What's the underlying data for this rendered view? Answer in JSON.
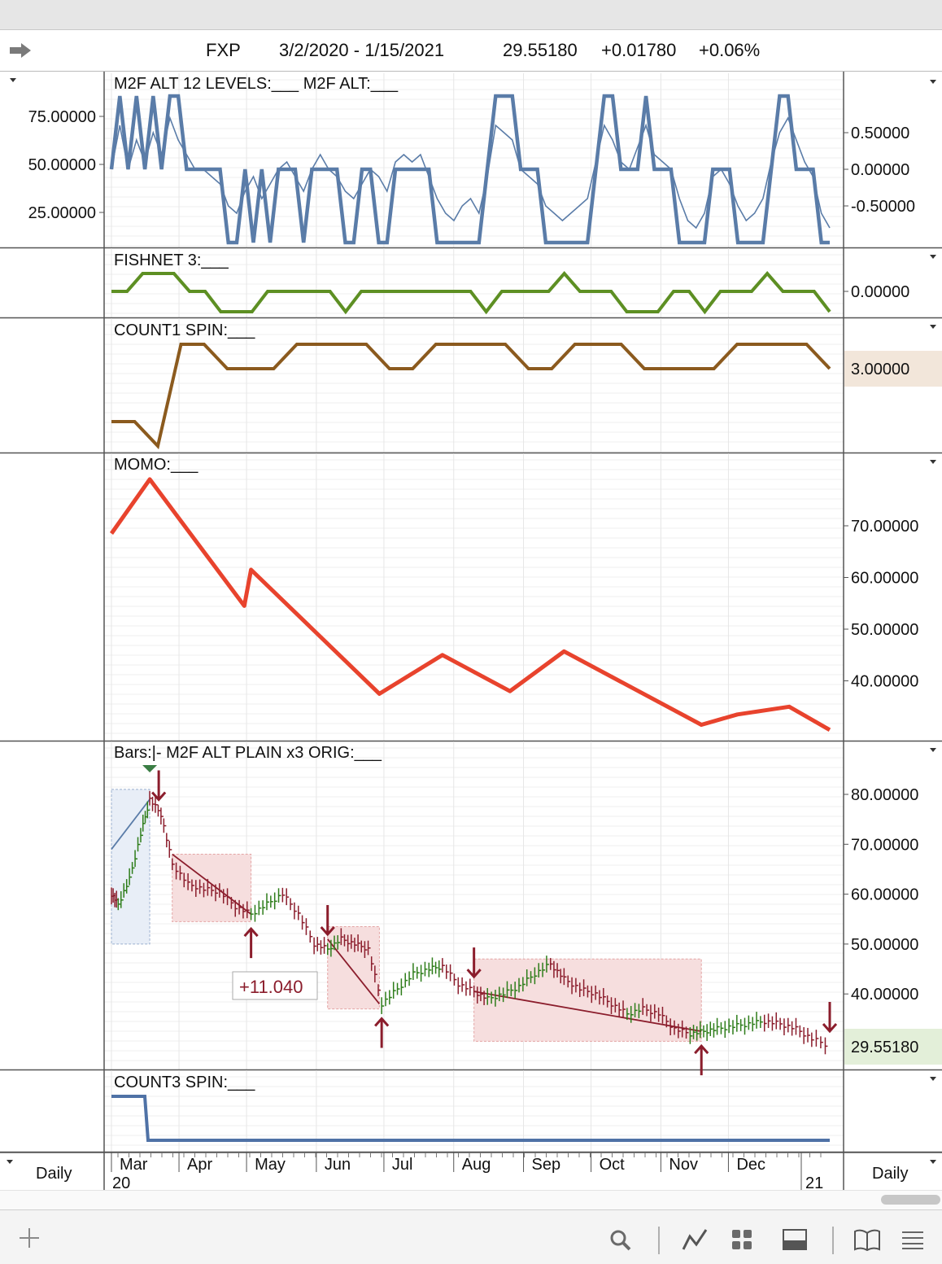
{
  "header": {
    "symbol": "FXP",
    "date_range": "3/2/2020 - 1/15/2021",
    "last": "29.55180",
    "change": "+0.01780",
    "change_pct": "+0.06%"
  },
  "footer": {
    "left_period": "Daily",
    "right_period": "Daily"
  },
  "colors": {
    "m2f": "#5a7ca8",
    "fishnet": "#5d8f23",
    "count1": "#8b5a1e",
    "momo": "#e8432d",
    "count3": "#4f72a6",
    "down_bar": "#8b1d2c",
    "up_bar": "#2e7d1a",
    "box_fill": "#f6dede"
  },
  "chart_data": [
    {
      "panel": "m2f",
      "type": "line",
      "title": "M2F ALT 12 LEVELS:___   M2F ALT:___",
      "left_ticks": [
        "75.00000",
        "50.00000",
        "25.00000"
      ],
      "right_ticks": [
        "0.50000",
        "0.00000",
        "-0.50000"
      ],
      "series": [
        {
          "name": "M2F ALT 12 LEVELS",
          "values": [
            50,
            100,
            50,
            100,
            50,
            100,
            50,
            100,
            100,
            50,
            50,
            50,
            50,
            50,
            0,
            0,
            50,
            0,
            50,
            0,
            50,
            50,
            50,
            0,
            50,
            50,
            50,
            50,
            0,
            0,
            50,
            50,
            0,
            0,
            50,
            50,
            50,
            50,
            50,
            0,
            0,
            0,
            0,
            0,
            0,
            50,
            100,
            100,
            100,
            50,
            50,
            50,
            0,
            0,
            0,
            0,
            0,
            0,
            50,
            100,
            100,
            50,
            50,
            50,
            100,
            50,
            50,
            50,
            0,
            0,
            0,
            0,
            50,
            50,
            50,
            0,
            0,
            0,
            0,
            50,
            100,
            100,
            50,
            50,
            50,
            0,
            0
          ]
        },
        {
          "name": "M2F ALT",
          "values": [
            50,
            80,
            50,
            70,
            55,
            75,
            60,
            85,
            70,
            60,
            50,
            50,
            45,
            40,
            25,
            20,
            35,
            45,
            30,
            40,
            50,
            55,
            45,
            35,
            50,
            60,
            50,
            45,
            35,
            30,
            40,
            50,
            45,
            35,
            55,
            60,
            55,
            60,
            45,
            30,
            20,
            15,
            25,
            30,
            20,
            45,
            80,
            75,
            70,
            50,
            45,
            40,
            25,
            20,
            15,
            20,
            25,
            30,
            55,
            80,
            70,
            55,
            50,
            65,
            80,
            60,
            55,
            50,
            30,
            15,
            10,
            20,
            45,
            50,
            40,
            25,
            15,
            20,
            30,
            55,
            75,
            85,
            70,
            55,
            45,
            20,
            10
          ]
        }
      ]
    },
    {
      "panel": "fishnet",
      "type": "line",
      "title": "FISHNET 3:___",
      "right_ticks": [
        "0.00000"
      ],
      "values": [
        0,
        0,
        1,
        1,
        1,
        0,
        0,
        -1,
        -1,
        -1,
        0,
        0,
        0,
        0,
        0,
        -1,
        0,
        0,
        0,
        0,
        0,
        0,
        0,
        0,
        -1,
        0,
        0,
        0,
        0,
        1,
        0,
        0,
        0,
        -1,
        -1,
        -1,
        0,
        0,
        -1,
        0,
        0,
        0,
        1,
        0,
        0,
        0,
        -1
      ]
    },
    {
      "panel": "count1",
      "type": "line",
      "title": "COUNT1 SPIN:___",
      "right_ticks": [
        "3.00000"
      ],
      "last_value": "3.00000",
      "values": [
        1,
        1,
        0,
        4,
        4,
        3,
        3,
        3,
        4,
        4,
        4,
        4,
        3,
        3,
        4,
        4,
        4,
        4,
        3,
        3,
        4,
        4,
        4,
        3,
        3,
        3,
        3,
        4,
        4,
        4,
        4,
        3
      ]
    },
    {
      "panel": "momo",
      "type": "line",
      "title": "MOMO:___",
      "y_ticks": [
        "70.00000",
        "60.00000",
        "50.00000",
        "40.00000"
      ],
      "ylim": [
        30,
        80
      ],
      "x": [
        "2020-03-02",
        "2020-03-19",
        "2020-04-30",
        "2020-05-03",
        "2020-06-29",
        "2020-07-27",
        "2020-08-26",
        "2020-09-19",
        "2020-11-19",
        "2020-12-05",
        "2020-12-28",
        "2021-01-15"
      ],
      "values": [
        68.5,
        79,
        54.5,
        61.5,
        37.5,
        45,
        38,
        45.7,
        31.5,
        33.5,
        35,
        30.5
      ]
    },
    {
      "panel": "price",
      "type": "line",
      "title": "Bars:|-   M2F ALT PLAIN x3 ORIG:___",
      "y_ticks": [
        "80.00000",
        "70.00000",
        "60.00000",
        "50.00000",
        "40.00000"
      ],
      "ylim": [
        25,
        85
      ],
      "last_price": "29.55180",
      "x": [
        "2020-03-02",
        "2020-03-05",
        "2020-03-10",
        "2020-03-15",
        "2020-03-19",
        "2020-03-24",
        "2020-03-29",
        "2020-04-05",
        "2020-04-12",
        "2020-04-19",
        "2020-04-26",
        "2020-05-03",
        "2020-05-10",
        "2020-05-17",
        "2020-05-24",
        "2020-05-31",
        "2020-06-06",
        "2020-06-12",
        "2020-06-18",
        "2020-06-24",
        "2020-06-30",
        "2020-07-07",
        "2020-07-14",
        "2020-07-21",
        "2020-07-27",
        "2020-08-03",
        "2020-08-10",
        "2020-08-16",
        "2020-08-23",
        "2020-08-30",
        "2020-09-06",
        "2020-09-13",
        "2020-09-19",
        "2020-09-26",
        "2020-10-03",
        "2020-10-10",
        "2020-10-17",
        "2020-10-24",
        "2020-10-31",
        "2020-11-07",
        "2020-11-14",
        "2020-11-20",
        "2020-11-26",
        "2020-12-03",
        "2020-12-10",
        "2020-12-17",
        "2020-12-24",
        "2020-12-31",
        "2021-01-07",
        "2021-01-15"
      ],
      "values": [
        60,
        58,
        63,
        72,
        79,
        76,
        66,
        62,
        61,
        60.5,
        57.5,
        56,
        58,
        60,
        56,
        50,
        49,
        51,
        50,
        49,
        38,
        41,
        44,
        45,
        45.5,
        42,
        40.5,
        39,
        40,
        41.5,
        44,
        46,
        43,
        41,
        40,
        38,
        36,
        37,
        36,
        33,
        32,
        32.5,
        33,
        33.5,
        34,
        34.5,
        34,
        33,
        31,
        29.6
      ],
      "annotations": [
        "+11.040"
      ],
      "regression_boxes": [
        {
          "from": "2020-03-02",
          "to": "2020-03-19",
          "high": 81,
          "low": 50,
          "start": 69,
          "end": 79,
          "direction": "up"
        },
        {
          "from": "2020-03-29",
          "to": "2020-05-03",
          "high": 68,
          "low": 54.5,
          "start": 68,
          "end": 56,
          "direction": "down"
        },
        {
          "from": "2020-06-06",
          "to": "2020-06-29",
          "high": 53.5,
          "low": 37,
          "start": 51,
          "end": 38,
          "direction": "down"
        },
        {
          "from": "2020-08-10",
          "to": "2020-11-19",
          "high": 47,
          "low": 30.5,
          "start": 40.5,
          "end": 32.5,
          "direction": "down"
        }
      ],
      "signals": [
        {
          "date": "2020-03-23",
          "type": "down"
        },
        {
          "date": "2020-05-03",
          "type": "up"
        },
        {
          "date": "2020-06-06",
          "type": "down"
        },
        {
          "date": "2020-06-30",
          "type": "up"
        },
        {
          "date": "2020-08-10",
          "type": "down"
        },
        {
          "date": "2020-11-19",
          "type": "up"
        },
        {
          "date": "2021-01-15",
          "type": "down"
        }
      ]
    },
    {
      "panel": "count3",
      "type": "line",
      "title": "COUNT3 SPIN:___",
      "values": [
        1,
        1,
        1,
        0,
        0,
        0,
        0,
        0,
        0,
        0
      ]
    }
  ],
  "x_axis": {
    "months": [
      "Mar",
      "Apr",
      "May",
      "Jun",
      "Jul",
      "Aug",
      "Sep",
      "Oct",
      "Nov",
      "Dec"
    ],
    "years": [
      "20",
      "21"
    ]
  }
}
